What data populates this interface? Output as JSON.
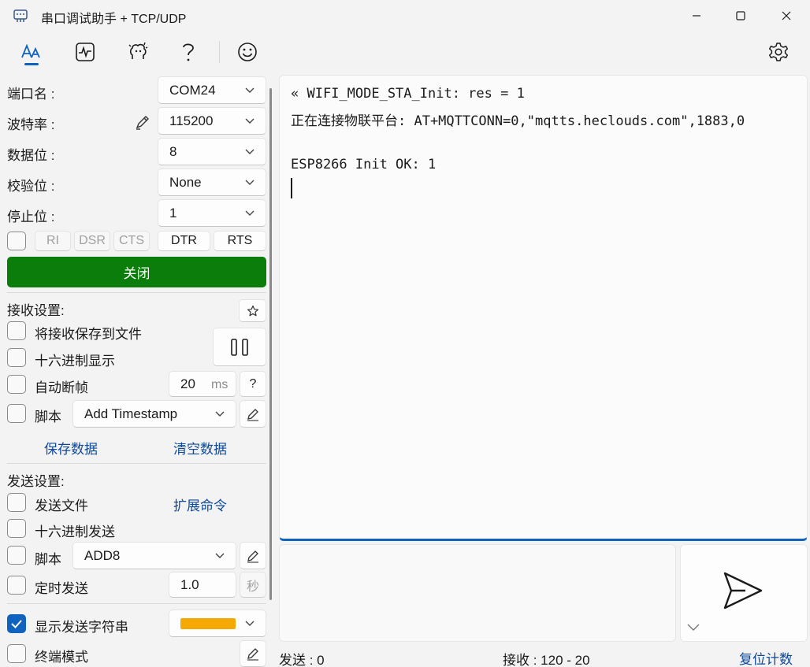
{
  "window": {
    "title": "串口调试助手 + TCP/UDP"
  },
  "toolbar": {
    "icons": [
      "font-icon",
      "activity-icon",
      "brain-icon",
      "help-icon",
      "smiley-icon",
      "settings-icon"
    ]
  },
  "serial": {
    "port_label": "端口名 :",
    "port_value": "COM24",
    "baud_label": "波特率 :",
    "baud_value": "115200",
    "databits_label": "数据位 :",
    "databits_value": "8",
    "parity_label": "校验位 :",
    "parity_value": "None",
    "stopbits_label": "停止位 :",
    "stopbits_value": "1",
    "ri": "RI",
    "dsr": "DSR",
    "cts": "CTS",
    "dtr": "DTR",
    "rts": "RTS",
    "close_label": "关闭"
  },
  "receive": {
    "title": "接收设置:",
    "save_to_file": "将接收保存到文件",
    "hex_display": "十六进制显示",
    "auto_frame": "自动断帧",
    "auto_frame_value": "20",
    "auto_frame_unit": "ms",
    "help": "?",
    "script": "脚本",
    "script_value": "Add Timestamp",
    "save_data": "保存数据",
    "clear_data": "清空数据"
  },
  "send": {
    "title": "发送设置:",
    "send_file": "发送文件",
    "extend_cmd": "扩展命令",
    "hex_send": "十六进制发送",
    "script": "脚本",
    "script_value": "ADD8",
    "timed_send": "定时发送",
    "timed_value": "1.0",
    "timed_unit": "秒",
    "show_send": "显示发送字符串",
    "show_send_color": "#f5a800",
    "terminal_mode": "终端模式"
  },
  "output": {
    "lines": [
      "« WIFI_MODE_STA_Init: res = 1",
      "正在连接物联平台: AT+MQTTCONN=0,\"mqtts.heclouds.com\",1883,0",
      "",
      "ESP8266 Init OK: 1"
    ]
  },
  "status": {
    "sent": "发送 : 0",
    "recv": "接收 : 120 - 20",
    "reset": "复位计数"
  },
  "colors": {
    "accent": "#0f62be",
    "open_button": "#0a7d0a",
    "link": "#0f4a9a"
  }
}
